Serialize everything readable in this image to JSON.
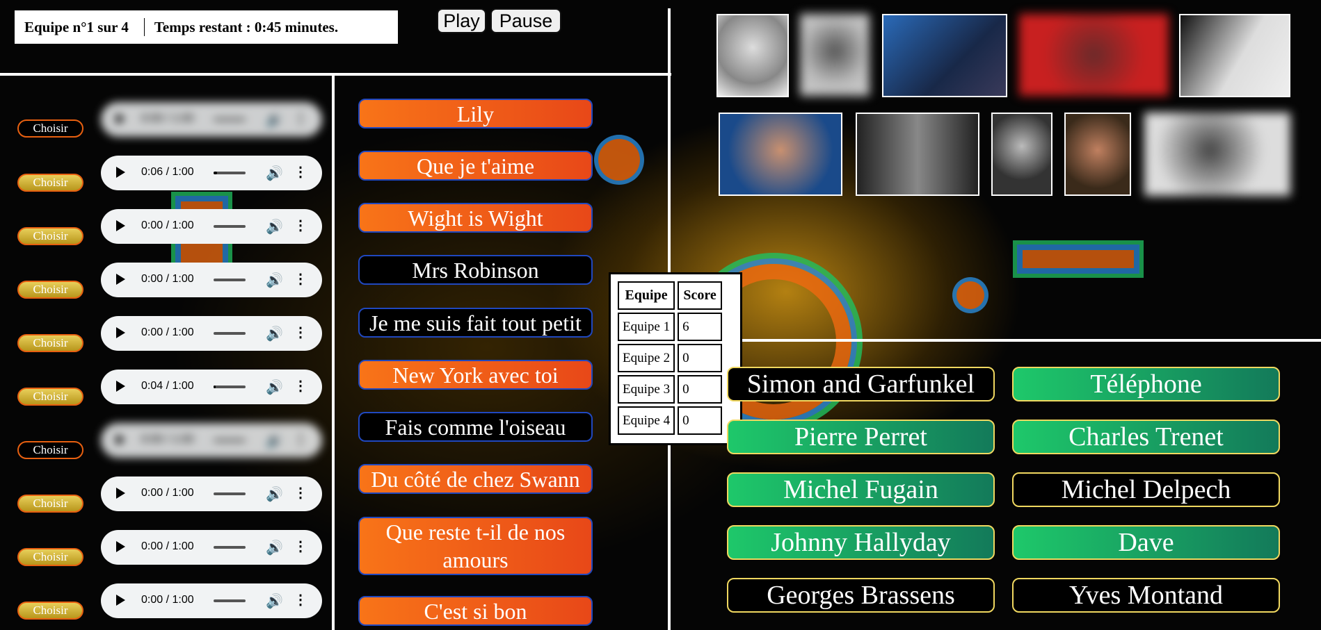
{
  "header": {
    "team_text": "Equipe n°1 sur 4",
    "time_text": "Temps restant : 0:45 minutes.",
    "play_label": "Play",
    "pause_label": "Pause"
  },
  "tracks": [
    {
      "choose_label": "Choisir",
      "style": "off",
      "time": "0:00 / 1:00",
      "blurred": true,
      "progress": 0
    },
    {
      "choose_label": "Choisir",
      "style": "on",
      "time": "0:06 / 1:00",
      "blurred": false,
      "progress": 0.1
    },
    {
      "choose_label": "Choisir",
      "style": "on",
      "time": "0:00 / 1:00",
      "blurred": false,
      "progress": 0
    },
    {
      "choose_label": "Choisir",
      "style": "on",
      "time": "0:00 / 1:00",
      "blurred": false,
      "progress": 0
    },
    {
      "choose_label": "Choisir",
      "style": "on",
      "time": "0:00 / 1:00",
      "blurred": false,
      "progress": 0
    },
    {
      "choose_label": "Choisir",
      "style": "on",
      "time": "0:04 / 1:00",
      "blurred": false,
      "progress": 0.07
    },
    {
      "choose_label": "Choisir",
      "style": "off",
      "time": "0:00 / 1:00",
      "blurred": true,
      "progress": 0
    },
    {
      "choose_label": "Choisir",
      "style": "on",
      "time": "0:00 / 1:00",
      "blurred": false,
      "progress": 0
    },
    {
      "choose_label": "Choisir",
      "style": "on",
      "time": "0:00 / 1:00",
      "blurred": false,
      "progress": 0
    },
    {
      "choose_label": "Choisir",
      "style": "on",
      "time": "0:00 / 1:00",
      "blurred": false,
      "progress": 0
    }
  ],
  "songs": [
    {
      "title": "Lily",
      "style": "orange"
    },
    {
      "title": "Que je t'aime",
      "style": "orange"
    },
    {
      "title": "Wight is Wight",
      "style": "orange"
    },
    {
      "title": "Mrs Robinson",
      "style": "black"
    },
    {
      "title": "Je me suis fait tout petit",
      "style": "black"
    },
    {
      "title": "New York avec toi",
      "style": "orange"
    },
    {
      "title": "Fais comme l'oiseau",
      "style": "black"
    },
    {
      "title": "Du côté de chez Swann",
      "style": "orange"
    },
    {
      "title": "Que reste t-il de nos amours",
      "style": "orange"
    },
    {
      "title": "C'est si bon",
      "style": "orange"
    }
  ],
  "scores": {
    "header_team": "Equipe",
    "header_score": "Score",
    "rows": [
      {
        "team": "Equipe 1",
        "score": "6"
      },
      {
        "team": "Equipe 2",
        "score": "0"
      },
      {
        "team": "Equipe 3",
        "score": "0"
      },
      {
        "team": "Equipe 4",
        "score": "0"
      }
    ]
  },
  "artists": [
    {
      "name": "Simon and Garfunkel",
      "style": "black"
    },
    {
      "name": "Téléphone",
      "style": "green"
    },
    {
      "name": "Pierre Perret",
      "style": "green"
    },
    {
      "name": "Charles Trenet",
      "style": "green"
    },
    {
      "name": "Michel Fugain",
      "style": "green"
    },
    {
      "name": "Michel Delpech",
      "style": "black"
    },
    {
      "name": "Johnny Hallyday",
      "style": "green"
    },
    {
      "name": "Dave",
      "style": "green"
    },
    {
      "name": "Georges Brassens",
      "style": "black"
    },
    {
      "name": "Yves Montand",
      "style": "black"
    }
  ],
  "icons": {
    "volume": "🔊",
    "more": "⋮"
  },
  "colors": {
    "song_orange": "#f87418",
    "artist_green": "#1ec86a",
    "choose_gold": "#e8cf5a",
    "button_border": "#e86010"
  }
}
